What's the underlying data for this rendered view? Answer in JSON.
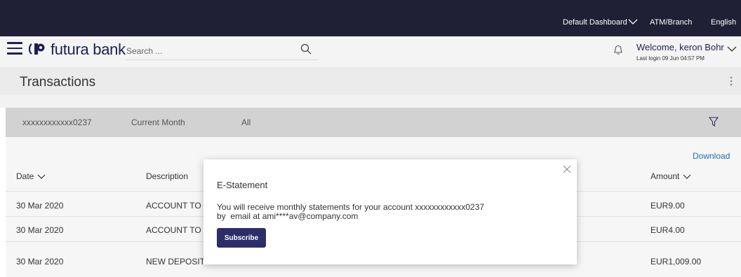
{
  "topbar": {
    "dashboard": "Default Dashboard",
    "atm_branch": "ATM/Branch",
    "language": "English"
  },
  "header": {
    "brand": "futura bank",
    "search_placeholder": "Search ...",
    "welcome": "Welcome, keron Bohr",
    "last_login": "Last login 09 Jun 04:57 PM"
  },
  "page": {
    "title": "Transactions"
  },
  "filters": {
    "account": "xxxxxxxxxxxx0237",
    "period": "Current Month",
    "type": "All"
  },
  "table": {
    "download_label": "Download",
    "columns": {
      "date": "Date",
      "description": "Description",
      "amount": "Amount"
    },
    "rows": [
      {
        "date": "30 Mar 2020",
        "description": "ACCOUNT TO ,",
        "amount": "EUR9.00"
      },
      {
        "date": "30 Mar 2020",
        "description": "ACCOUNT TO ,",
        "amount": "EUR4.00"
      },
      {
        "date": "30 Mar 2020",
        "description": "NEW DEPOSIT",
        "amount": "EUR1,009.00"
      }
    ]
  },
  "modal": {
    "title": "E-Statement",
    "message": "You will receive monthly statements for your account xxxxxxxxxxxx0237",
    "by_text": "by  email at ami****av@company.com",
    "subscribe_label": "Subscribe"
  },
  "colors": {
    "topbar_bg": "#1f1f35",
    "brand": "#1f1f55",
    "button": "#2d2d6b",
    "link": "#1f6fb0"
  }
}
